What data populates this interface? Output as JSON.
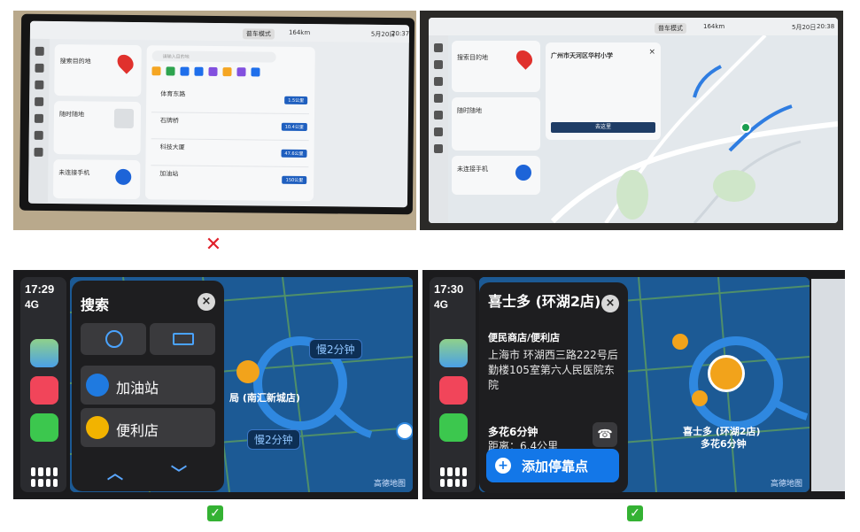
{
  "panel1": {
    "mode": "普车模式",
    "distance": "164km",
    "date": "5月20日",
    "time": "20:37",
    "search_prompt": "搜索目的地",
    "search_placeholder": "请输入目的地",
    "music_title": "随时随地",
    "bt_label": "未连接手机",
    "list": [
      {
        "name": "体育东路",
        "dist": "1.5公里"
      },
      {
        "name": "石牌桥",
        "dist": "10.4公里"
      },
      {
        "name": "科技大厦",
        "dist": "47.6公里"
      },
      {
        "name": "加油站",
        "dist": "150公里"
      }
    ]
  },
  "panel2": {
    "mode": "普车模式",
    "distance": "164km",
    "date": "5月20日",
    "time": "20:38",
    "search_prompt": "搜索目的地",
    "poi_title": "广州市天河区华村小学",
    "go_label": "去这里",
    "music_title": "随时随地",
    "bt_label": "未连接手机"
  },
  "panel3": {
    "time": "17:29",
    "signal": "4G",
    "title": "搜索",
    "items": [
      {
        "label": "加油站",
        "color": "#1f7ae0"
      },
      {
        "label": "便利店",
        "color": "#f2b300"
      }
    ],
    "bubble1": "慢2分钟",
    "bubble2": "慢2分钟",
    "place_label": "局 (南汇新城店)",
    "watermark": "高德地图"
  },
  "panel4": {
    "time": "17:30",
    "signal": "4G",
    "poi_name": "喜士多 (环湖2店)",
    "poi_category": "便民商店/便利店",
    "poi_address": "上海市 环湖西三路222号后勤楼105室第六人民医院东院",
    "eta": "多花6分钟",
    "distance": "距离：6.4公里",
    "add_stop": "添加停靠点",
    "map_label_name": "喜士多 (环湖2店)",
    "map_label_eta": "多花6分钟",
    "watermark": "高德地图"
  },
  "marks": {
    "cross": "✕",
    "check3": "✓",
    "check4": "✓"
  }
}
